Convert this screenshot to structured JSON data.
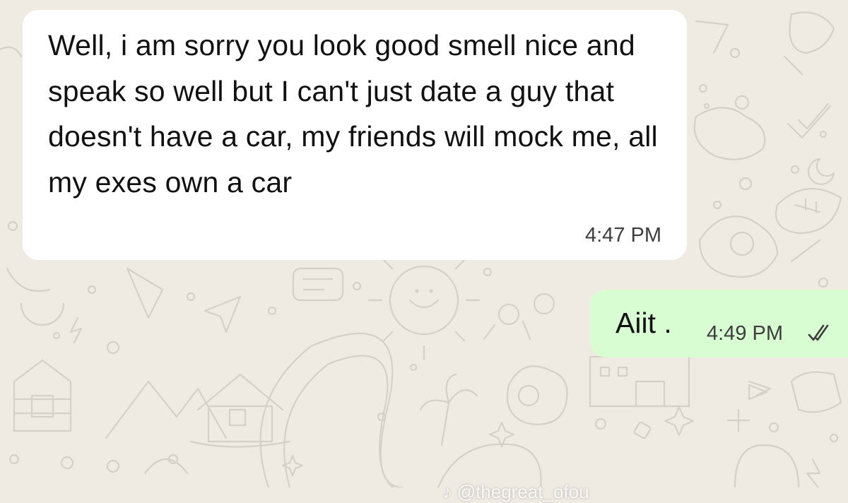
{
  "colors": {
    "background": "#efeae2",
    "incoming_bubble": "#ffffff",
    "outgoing_bubble": "#d9fdd3",
    "text": "#111111",
    "timestamp": "#3d3d3d",
    "pattern": "#d4cfc6"
  },
  "messages": [
    {
      "direction": "incoming",
      "text": "Well, i am sorry you look good smell nice and speak so well but I can't just date a guy that doesn't have a car, my friends will mock me, all my exes own a car",
      "time": "4:47 PM"
    },
    {
      "direction": "outgoing",
      "text": "Aiit .",
      "time": "4:49 PM",
      "status_icon": "double-check-icon"
    }
  ],
  "watermark": {
    "text": "@thegreat_ofou"
  }
}
